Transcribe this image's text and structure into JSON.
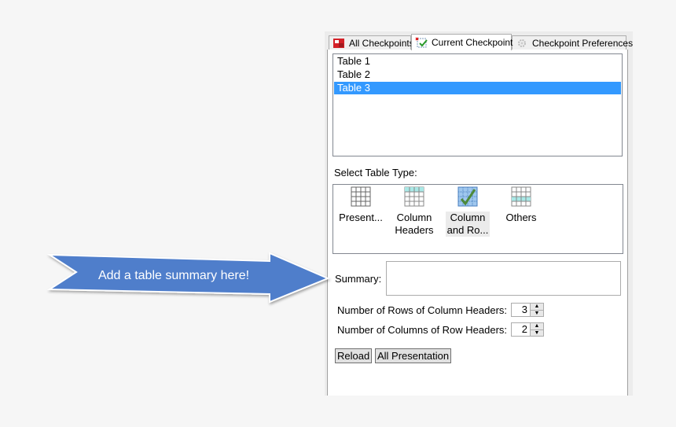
{
  "tabs": [
    {
      "label": "All Checkpoints",
      "icon": "red-checkpoints-icon",
      "active": false
    },
    {
      "label": "Current Checkpoint",
      "icon": "current-checkpoint-icon",
      "active": true
    },
    {
      "label": "Checkpoint Preferences",
      "icon": "gear-icon",
      "active": false
    }
  ],
  "tables_list": {
    "items": [
      "Table 1",
      "Table 2",
      "Table 3"
    ],
    "selected_index": 2
  },
  "table_type": {
    "label": "Select Table Type:",
    "options": [
      {
        "line1": "Present...",
        "line2": "",
        "icon": "presentation-table-icon",
        "selected": false
      },
      {
        "line1": "Column",
        "line2": "Headers",
        "icon": "column-headers-table-icon",
        "selected": false
      },
      {
        "line1": "Column",
        "line2": "and Ro...",
        "icon": "column-and-row-headers-table-icon",
        "selected": true
      },
      {
        "line1": "Others",
        "line2": "",
        "icon": "other-table-icon",
        "selected": false
      }
    ]
  },
  "summary": {
    "label": "Summary:",
    "value": ""
  },
  "rows_of_column_headers": {
    "label": "Number of Rows of Column Headers:",
    "value": "3"
  },
  "columns_of_row_headers": {
    "label": "Number of Columns of Row Headers:",
    "value": "2"
  },
  "buttons": {
    "reload": "Reload",
    "all_presentation": "All Presentation"
  },
  "callout": {
    "text": "Add a table summary here!",
    "color": "#4f7ecb"
  },
  "colors": {
    "selection": "#3399ff"
  }
}
